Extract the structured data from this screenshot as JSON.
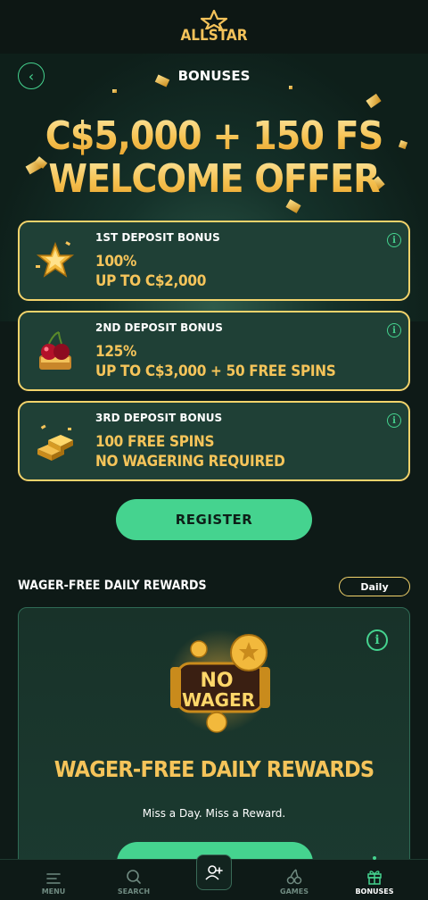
{
  "brand": {
    "name": "ALLSTAR"
  },
  "header": {
    "title": "BONUSES"
  },
  "hero": {
    "line1": "C$5,000 + 150 FS",
    "line2": "WELCOME OFFER"
  },
  "bonuses": [
    {
      "label": "1ST DEPOSIT BONUS",
      "line1": "100%",
      "line2": "UP TO C$2,000",
      "icon": "star-icon"
    },
    {
      "label": "2ND DEPOSIT BONUS",
      "line1": "125%",
      "line2": "UP TO C$3,000 + 50 FREE SPINS",
      "icon": "cherry-icon"
    },
    {
      "label": "3RD DEPOSIT BONUS",
      "line1": "100 FREE SPINS",
      "line2": "NO WAGERING REQUIRED",
      "icon": "gold-bars-icon"
    }
  ],
  "register_label": "REGISTER",
  "daily_rewards": {
    "section_title": "WAGER-FREE DAILY REWARDS",
    "badge": "Daily",
    "art_text_top": "NO",
    "art_text_bottom": "WAGER",
    "title": "WAGER-FREE DAILY REWARDS",
    "subtitle": "Miss a Day. Miss a Reward."
  },
  "nav": {
    "menu": "MENU",
    "search": "SEARCH",
    "games": "GAMES",
    "bonuses": "BONUSES",
    "active": "bonuses"
  },
  "colors": {
    "accent": "#45d38f",
    "gold": "#f5c45a",
    "card": "#1f4036",
    "background": "#0e1a17"
  }
}
